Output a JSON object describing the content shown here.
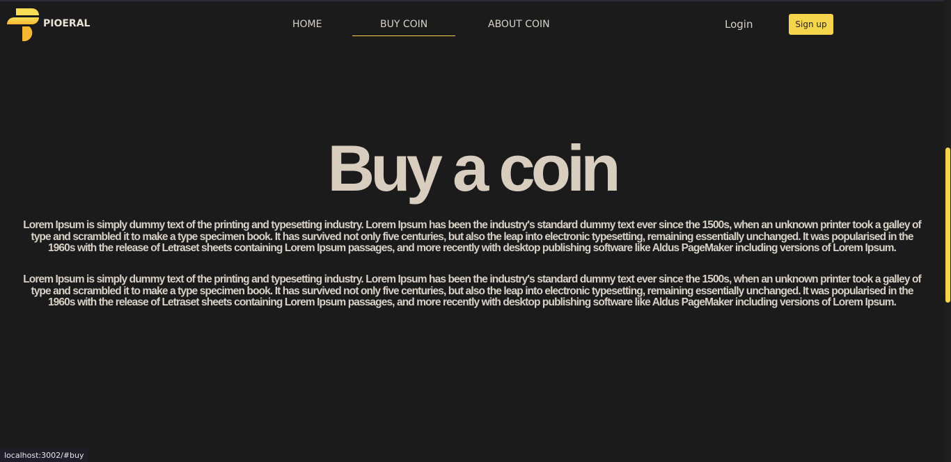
{
  "brand": {
    "name": "PIOERAL",
    "accent": "#f5d54c"
  },
  "nav": [
    {
      "label": "HOME"
    },
    {
      "label": "BUY COIN",
      "active": true
    },
    {
      "label": "ABOUT COIN"
    }
  ],
  "auth": {
    "login": "Login",
    "signup": "Sign up"
  },
  "hero": {
    "title": "Buy a coin",
    "paragraphs": [
      "Lorem Ipsum is simply dummy text of the printing and typesetting industry. Lorem Ipsum has been the industry's standard dummy text ever since the 1500s, when an unknown printer took a galley of type and scrambled it to make a type specimen book. It has survived not only five centuries, but also the leap into electronic typesetting, remaining essentially unchanged. It was popularised in the 1960s with the release of Letraset sheets containing Lorem Ipsum passages, and more recently with desktop publishing software like Aldus PageMaker including versions of Lorem Ipsum.",
      "Lorem Ipsum is simply dummy text of the printing and typesetting industry. Lorem Ipsum has been the industry's standard dummy text ever since the 1500s, when an unknown printer took a galley of type and scrambled it to make a type specimen book. It has survived not only five centuries, but also the leap into electronic typesetting, remaining essentially unchanged. It was popularised in the 1960s with the release of Letraset sheets containing Lorem Ipsum passages, and more recently with desktop publishing software like Aldus PageMaker including versions of Lorem Ipsum."
    ]
  },
  "status_url": "localhost:3002/#buy"
}
